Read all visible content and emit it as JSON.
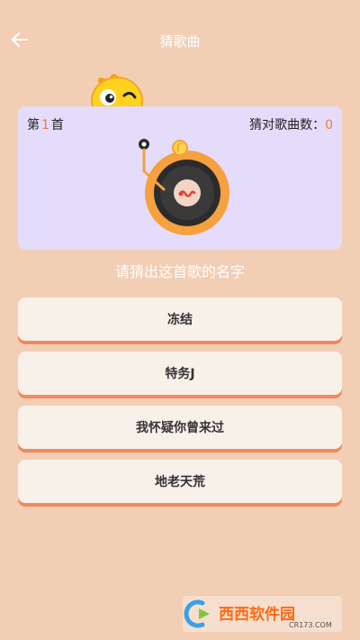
{
  "header": {
    "title": "猜歌曲",
    "back_icon": "arrow-left-icon"
  },
  "card": {
    "round_prefix": "第",
    "round_number": "1",
    "round_suffix": "首",
    "score_label": "猜对歌曲数：",
    "score_value": "0",
    "record_icon": "vinyl-record-icon"
  },
  "prompt": "请猜出这首歌的名字",
  "options": [
    "冻结",
    "特务J",
    "我怀疑你曾来过",
    "地老天荒"
  ],
  "watermark": {
    "brand": "西西软件园",
    "url": "CR173.COM"
  },
  "colors": {
    "background": "#f2ceb5",
    "card": "#e4dcfa",
    "accent": "#ee7a3c",
    "option": "#f8f1ea",
    "option_shadow": "#f08a5c"
  }
}
